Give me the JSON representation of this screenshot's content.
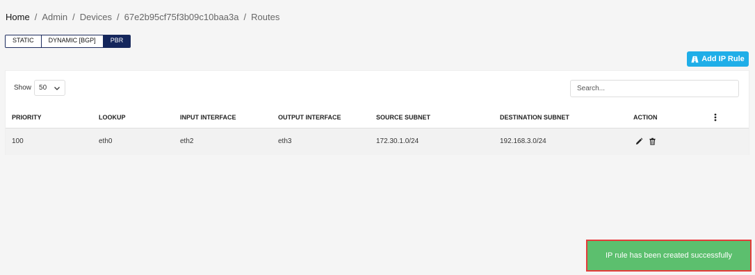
{
  "breadcrumb": {
    "items": [
      "Home",
      "Admin",
      "Devices",
      "67e2b95cf75f3b09c10baa3a",
      "Routes"
    ],
    "separator": "/"
  },
  "tabs": [
    {
      "label": "STATIC",
      "active": false
    },
    {
      "label": "DYNAMIC [BGP]",
      "active": false
    },
    {
      "label": "PBR",
      "active": true
    }
  ],
  "add_button": {
    "label": "Add IP Rule",
    "icon": "road-icon"
  },
  "table_controls": {
    "show_label": "Show",
    "page_size": "50",
    "search_placeholder": "Search..."
  },
  "table": {
    "columns": [
      "PRIORITY",
      "LOOKUP",
      "INPUT INTERFACE",
      "OUTPUT INTERFACE",
      "SOURCE SUBNET",
      "DESTINATION SUBNET",
      "ACTION"
    ],
    "rows": [
      {
        "priority": "100",
        "lookup": "eth0",
        "input_interface": "eth2",
        "output_interface": "eth3",
        "source_subnet": "172.30.1.0/24",
        "destination_subnet": "192.168.3.0/24"
      }
    ]
  },
  "toast": {
    "message": "IP rule has been created successfully"
  },
  "colors": {
    "accent": "#1faee8",
    "tab_active": "#14265c",
    "toast_bg": "#5cbf6e",
    "highlight_border": "#e53a3a"
  }
}
